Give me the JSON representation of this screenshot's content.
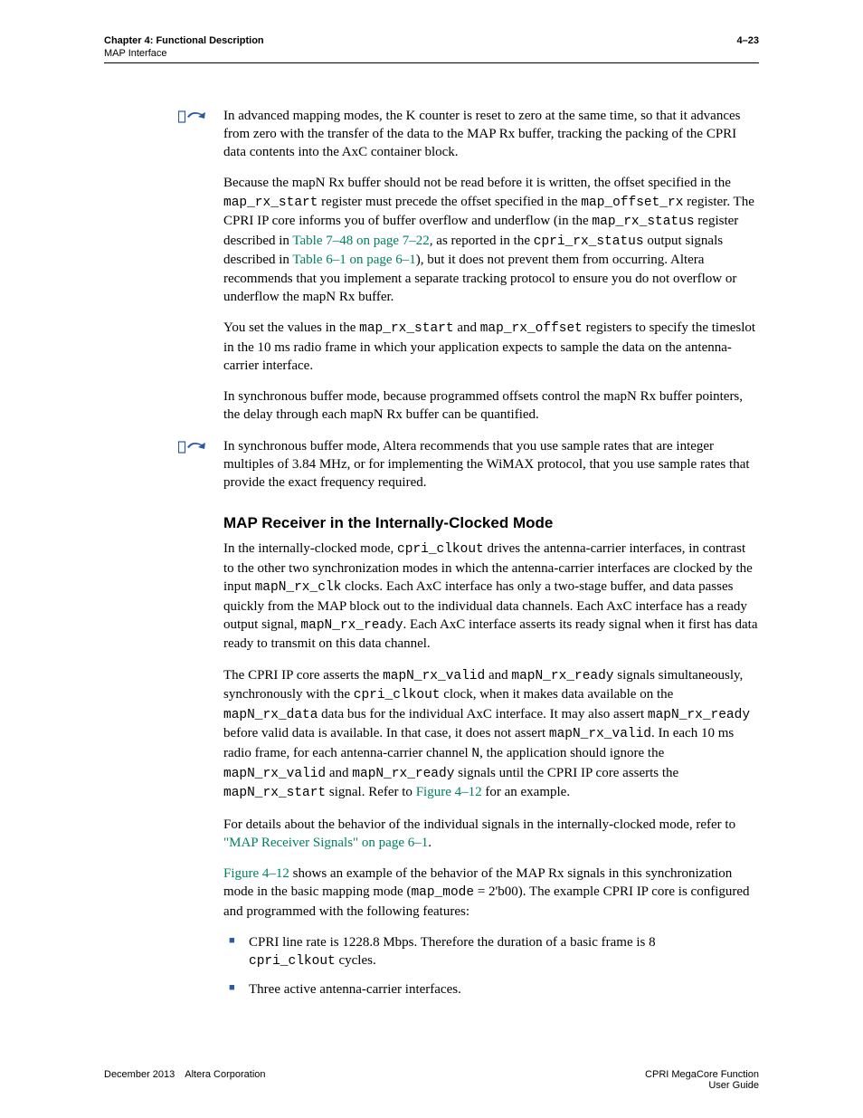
{
  "header": {
    "chapter": "Chapter 4: Functional Description",
    "section": "MAP Interface",
    "pagenum": "4–23"
  },
  "body": {
    "p1": "In advanced mapping modes, the K counter is reset to zero at the same time, so that it advances from zero with the transfer of the data to the MAP Rx buffer, tracking the packing of the CPRI data contents into the AxC container block.",
    "p2a": "Because the mapN Rx buffer should not be read before it is written, the offset specified in the ",
    "p2_reg1": "map_rx_start",
    "p2b": " register must precede the offset specified in the ",
    "p2_reg2": "map_offset_rx",
    "p2c": " register. The CPRI IP core informs you of buffer overflow and underflow (in the ",
    "p2_reg3": "map_rx_status",
    "p2d": " register described in ",
    "p2_link1": "Table 7–48 on page 7–22",
    "p2e": ", as reported in the ",
    "p2_reg4": "cpri_rx_status",
    "p2f": " output signals described in ",
    "p2_link2": "Table 6–1 on page 6–1",
    "p2g": "), but it does not prevent them from occurring. Altera recommends that you implement a separate tracking protocol to ensure you do not overflow or underflow the mapN Rx buffer.",
    "p3a": "You set the values in the ",
    "p3_reg1": "map_rx_start",
    "p3b": " and ",
    "p3_reg2": "map_rx_offset",
    "p3c": " registers to specify the timeslot in the 10 ms radio frame in which your application expects to sample the data on the antenna-carrier interface.",
    "p4": "In synchronous buffer mode, because programmed offsets control the mapN Rx buffer pointers, the delay through each mapN Rx buffer can be quantified.",
    "p5": "In synchronous buffer mode, Altera recommends that you use sample rates that are integer multiples of 3.84 MHz, or for implementing the WiMAX protocol, that you use sample rates that provide the exact frequency required.",
    "h1": "MAP Receiver in the Internally-Clocked Mode",
    "p6a": "In the internally-clocked mode, ",
    "p6_c1": "cpri_clkout",
    "p6b": " drives the antenna-carrier interfaces, in contrast to the other two synchronization modes in which the antenna-carrier interfaces are clocked by the input ",
    "p6_c2": "mapN_rx_clk",
    "p6c": " clocks. Each AxC interface has only a two-stage buffer, and data passes quickly from the MAP block out to the individual data channels. Each AxC interface has a ready output signal, ",
    "p6_c3": "mapN_rx_ready",
    "p6d": ". Each AxC interface asserts its ready signal when it first has data ready to transmit on this data channel.",
    "p7a": "The CPRI IP core asserts the ",
    "p7_c1": "mapN_rx_valid",
    "p7b": " and ",
    "p7_c2": "mapN_rx_ready",
    "p7c": " signals simultaneously, synchronously with the ",
    "p7_c3": "cpri_clkout",
    "p7d": " clock, when it makes data available on the ",
    "p7_c4": "mapN_rx_data",
    "p7e": " data bus for the individual AxC interface. It may also assert ",
    "p7_c5": "mapN_rx_ready",
    "p7f": " before valid data is available. In that case, it does not assert ",
    "p7_c6": "mapN_rx_valid",
    "p7g": ". In each 10 ms radio frame, for each antenna-carrier channel ",
    "p7_cN": "N",
    "p7h": ", the application should ignore the ",
    "p7_c7": "mapN_rx_valid",
    "p7i": " and ",
    "p7_c8": "mapN_rx_ready",
    "p7j": " signals until the CPRI IP core asserts the ",
    "p7_c9": "mapN_rx_start",
    "p7k": " signal. Refer to ",
    "p7_link": "Figure 4–12",
    "p7l": " for an example.",
    "p8a": "For details about the behavior of the individual signals in the internally-clocked mode, refer to ",
    "p8_link": "\"MAP Receiver Signals\" on page 6–1",
    "p8b": ".",
    "p9_link": "Figure 4–12",
    "p9a": " shows an example of the behavior of the MAP Rx signals in this synchronization mode in the basic mapping mode (",
    "p9_c1": "map_mode",
    "p9b": " = 2'b00). The example CPRI IP core is configured and programmed with the following features:",
    "b1a": "CPRI line rate is 1228.8 Mbps. Therefore the duration of a basic frame is 8 ",
    "b1_c": "cpri_clkout",
    "b1b": " cycles.",
    "b2": "Three active antenna-carrier interfaces."
  },
  "footer": {
    "left": "December 2013 Altera Corporation",
    "right1": "CPRI MegaCore Function",
    "right2": "User Guide"
  }
}
